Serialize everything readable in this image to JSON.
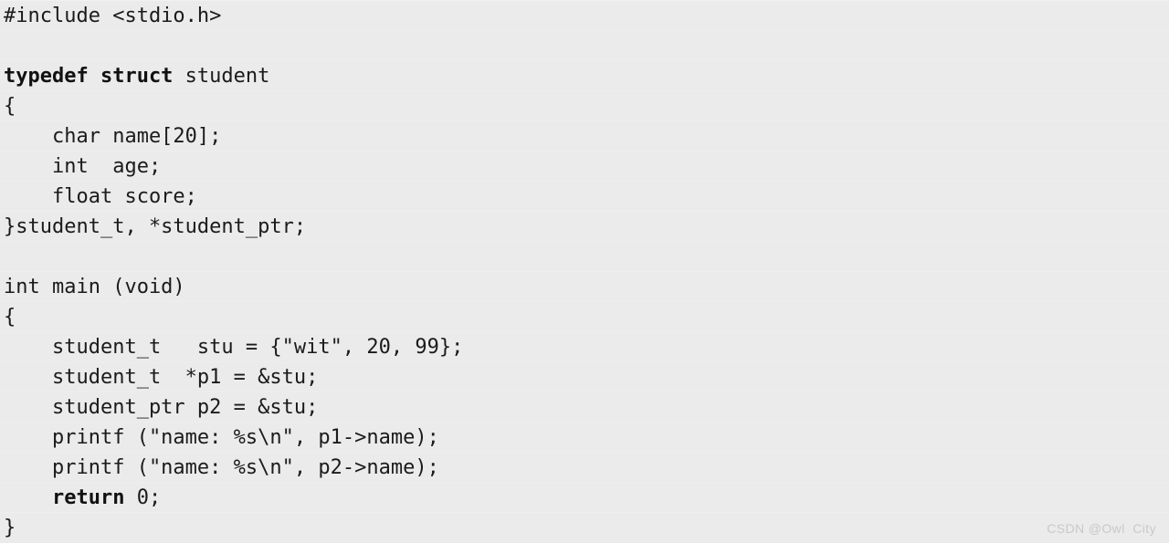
{
  "editor": {
    "background_color": "#ebebeb",
    "text_color": "#1b1b1b",
    "line_separator_color": "#eeeeee",
    "language": "c",
    "font_size_px": 22,
    "line_height_px": 33
  },
  "code": {
    "lines": [
      {
        "n": 1,
        "segments": [
          {
            "text": "#include <stdio.h>",
            "bold": false
          }
        ]
      },
      {
        "n": 2,
        "segments": [
          {
            "text": "",
            "bold": false
          }
        ]
      },
      {
        "n": 3,
        "segments": [
          {
            "text": "typedef struct",
            "bold": true
          },
          {
            "text": " student",
            "bold": false
          }
        ]
      },
      {
        "n": 4,
        "segments": [
          {
            "text": "{",
            "bold": false
          }
        ]
      },
      {
        "n": 5,
        "segments": [
          {
            "text": "    char name[20];",
            "bold": false
          }
        ]
      },
      {
        "n": 6,
        "segments": [
          {
            "text": "    int  age;",
            "bold": false
          }
        ]
      },
      {
        "n": 7,
        "segments": [
          {
            "text": "    float score;",
            "bold": false
          }
        ]
      },
      {
        "n": 8,
        "segments": [
          {
            "text": "}student_t, *student_ptr;",
            "bold": false
          }
        ]
      },
      {
        "n": 9,
        "segments": [
          {
            "text": "",
            "bold": false
          }
        ]
      },
      {
        "n": 10,
        "segments": [
          {
            "text": "int main (void)",
            "bold": false
          }
        ]
      },
      {
        "n": 11,
        "segments": [
          {
            "text": "{",
            "bold": false
          }
        ]
      },
      {
        "n": 12,
        "segments": [
          {
            "text": "    student_t   stu = {\"wit\", 20, 99};",
            "bold": false
          }
        ]
      },
      {
        "n": 13,
        "segments": [
          {
            "text": "    student_t  *p1 = &stu;",
            "bold": false
          }
        ]
      },
      {
        "n": 14,
        "segments": [
          {
            "text": "    student_ptr p2 = &stu;",
            "bold": false
          }
        ]
      },
      {
        "n": 15,
        "segments": [
          {
            "text": "    printf (\"name: %s\\n\", p1->name);",
            "bold": false
          }
        ]
      },
      {
        "n": 16,
        "segments": [
          {
            "text": "    printf (\"name: %s\\n\", p2->name);",
            "bold": false
          }
        ]
      },
      {
        "n": 17,
        "segments": [
          {
            "text": "    ",
            "bold": false
          },
          {
            "text": "return",
            "bold": true
          },
          {
            "text": " 0;",
            "bold": false
          }
        ]
      },
      {
        "n": 18,
        "segments": [
          {
            "text": "}",
            "bold": false
          }
        ]
      }
    ]
  },
  "watermark": {
    "text": "CSDN @Owl  City",
    "color": "#c9c9c9"
  }
}
